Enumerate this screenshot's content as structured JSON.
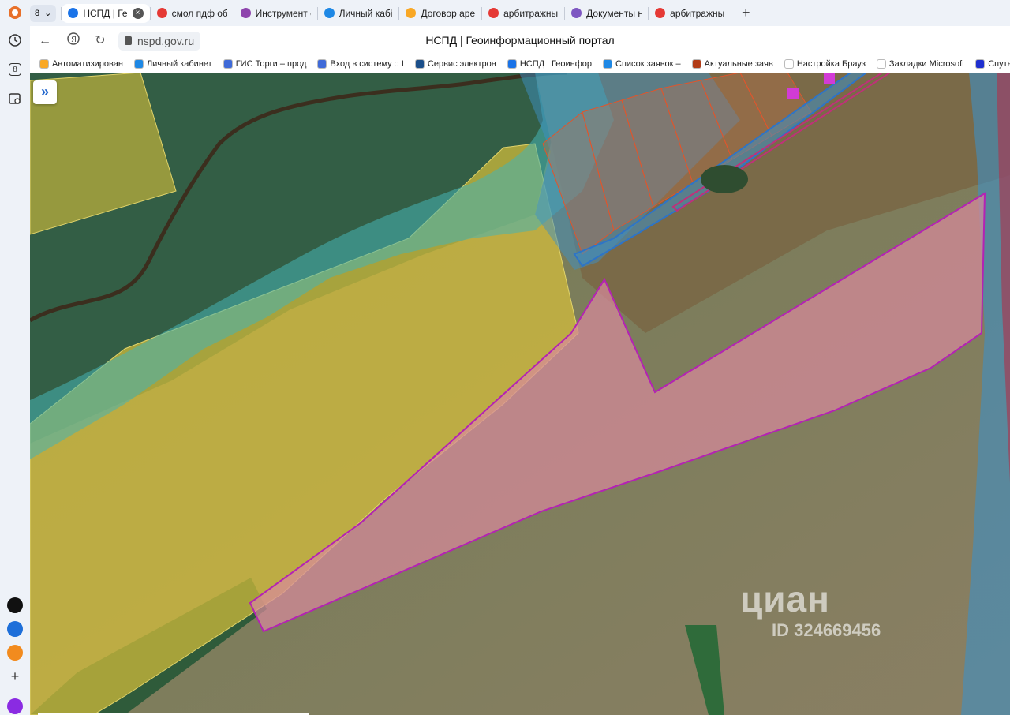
{
  "browser": {
    "tab_group_count": "8",
    "tabs": [
      {
        "label": "НСПД | Ге",
        "active": true,
        "fav": "#1a73e8"
      },
      {
        "label": "смол пдф об",
        "fav": "#e53935"
      },
      {
        "label": "Инструмент с",
        "fav": "#8e44ad"
      },
      {
        "label": "Личный кабі",
        "fav": "#1e88e5"
      },
      {
        "label": "Договор аре",
        "fav": "#f9a825"
      },
      {
        "label": "арбитражны",
        "fav": "#e53935"
      },
      {
        "label": "Документы н",
        "fav": "#7e57c2"
      },
      {
        "label": "арбитражны",
        "fav": "#e53935"
      }
    ],
    "url": "nspd.gov.ru",
    "page_title": "НСПД | Геоинформационный портал",
    "bookmarks": [
      {
        "label": "Автоматизирован",
        "fav": "#f9a825"
      },
      {
        "label": "Личный кабинет",
        "fav": "#1e88e5"
      },
      {
        "label": "ГИС Торги – прод",
        "fav": "#3f6ad8"
      },
      {
        "label": "Вход в систему :: І",
        "fav": "#3f6ad8"
      },
      {
        "label": "Сервис электрон",
        "fav": "#1b4f8a"
      },
      {
        "label": "НСПД | Геоинфор",
        "fav": "#1a73e8"
      },
      {
        "label": "Список заявок –",
        "fav": "#1e88e5"
      },
      {
        "label": "Актуальные заяв",
        "fav": "#b23c17"
      },
      {
        "label": "Настройка Брауз",
        "fav": "#ffffff"
      },
      {
        "label": "Закладки Microsoft",
        "fav": "#ffffff"
      },
      {
        "label": "Спутниковые карт",
        "fav": "#1e2fcf"
      }
    ]
  },
  "map": {
    "watermark_brand": "циан",
    "watermark_id": "ID 324669456",
    "colors": {
      "yellow_zone": "#d8c13a",
      "teal_zone": "#4fb7b2",
      "blue_zone": "#3e8fc4",
      "pink_parcel": "#d98a9c",
      "parcel_outline": "#b422b4",
      "field": "#7e7c58",
      "forest": "#3b6a47"
    }
  }
}
